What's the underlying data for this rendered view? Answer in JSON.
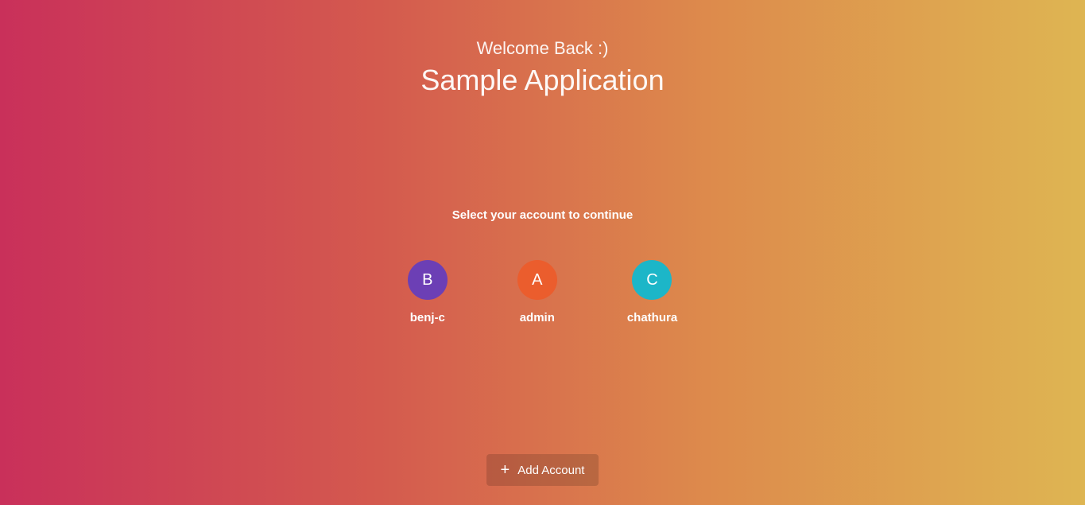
{
  "header": {
    "welcome": "Welcome Back :)",
    "appTitle": "Sample Application"
  },
  "prompt": "Select your account to continue",
  "accounts": [
    {
      "initial": "B",
      "name": "benj-c"
    },
    {
      "initial": "A",
      "name": "admin"
    },
    {
      "initial": "C",
      "name": "chathura"
    }
  ],
  "addAccount": {
    "label": "Add Account"
  }
}
